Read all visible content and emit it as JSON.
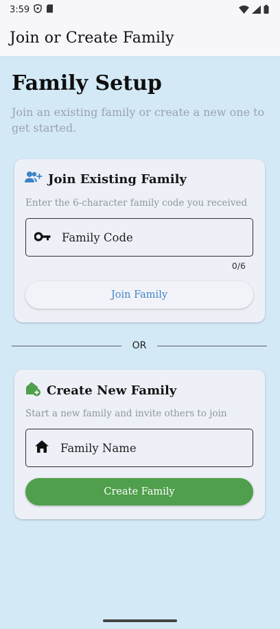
{
  "status_bar": {
    "time": "3:59"
  },
  "app_bar": {
    "title": "Join or Create Family"
  },
  "page": {
    "title": "Family Setup",
    "subtitle": "Join an existing family or create a new one to get started."
  },
  "join_card": {
    "title": "Join Existing Family",
    "description": "Enter the 6-character family code you received",
    "field_placeholder": "Family Code",
    "counter": "0/6",
    "button_label": "Join Family",
    "icon": "group-add-icon",
    "field_icon": "key-icon"
  },
  "divider": {
    "label": "OR"
  },
  "create_card": {
    "title": "Create New Family",
    "description": "Start a new family and invite others to join",
    "field_placeholder": "Family Name",
    "button_label": "Create Family",
    "icon": "add-home-icon",
    "field_icon": "home-icon"
  },
  "colors": {
    "background": "#d3e9f6",
    "card": "#eef0f8",
    "accent_blue": "#3d84c6",
    "accent_green": "#4f9f4c"
  }
}
